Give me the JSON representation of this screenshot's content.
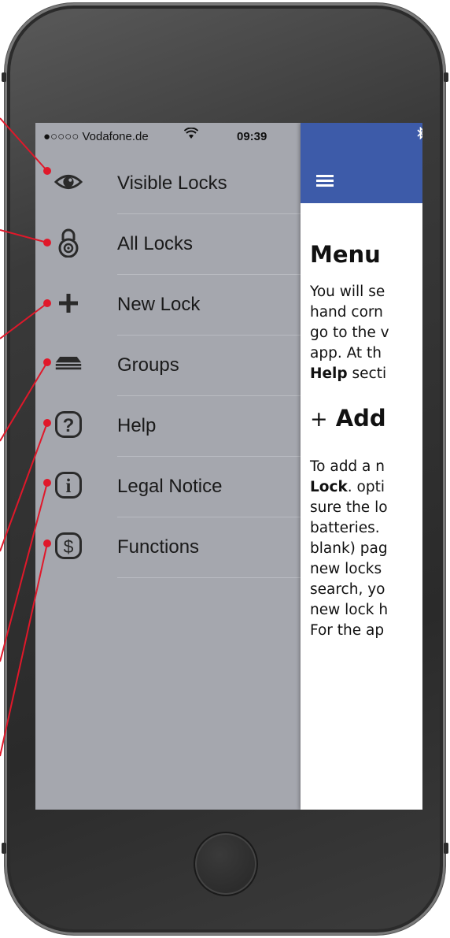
{
  "status_bar": {
    "carrier": "●○○○○ Vodafone.de",
    "wifi_icon": "wifi-icon",
    "time": "09:39",
    "bluetooth_icon": "bluetooth-icon"
  },
  "drawer": {
    "items": [
      {
        "label": "Visible Locks",
        "icon": "eye-icon"
      },
      {
        "label": "All Locks",
        "icon": "padlock-icon"
      },
      {
        "label": "New Lock",
        "icon": "plus-icon"
      },
      {
        "label": "Groups",
        "icon": "stack-icon"
      },
      {
        "label": "Help",
        "icon": "question-icon"
      },
      {
        "label": "Legal Notice",
        "icon": "info-icon"
      },
      {
        "label": "Functions",
        "icon": "dollar-icon"
      }
    ]
  },
  "content": {
    "header_color": "#3d5ba9",
    "menu_icon": "hamburger-icon",
    "heading": "Menu",
    "intro_lines": [
      "You will se",
      "hand corn",
      "go to the v",
      "app. At th"
    ],
    "help_bold": "Help",
    "help_rest": " secti",
    "section_plus": "+",
    "section_title": "Add",
    "body_lock_start": "To add a n",
    "body_lock_bold": "Lock",
    "body_lock_rest": ". opti",
    "body_lines": [
      "sure the lo",
      "batteries.",
      "blank) pag",
      "new locks",
      "search, yo",
      "new lock h",
      "For the ap"
    ]
  },
  "colors": {
    "drawer_bg": "#a5a7ae",
    "callout_red": "#e0182a",
    "header_blue": "#3d5ba9"
  }
}
